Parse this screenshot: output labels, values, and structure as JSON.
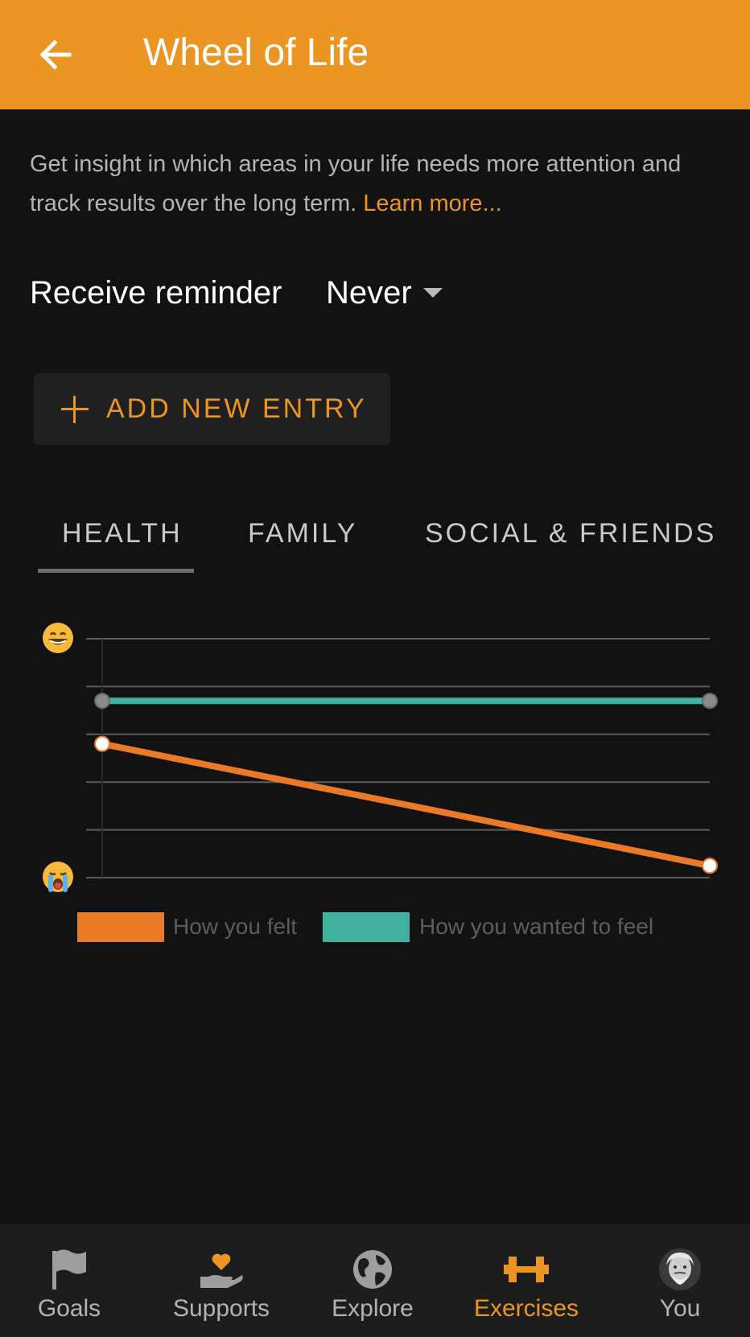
{
  "appbar": {
    "title": "Wheel of Life"
  },
  "intro": {
    "text": "Get insight in which areas in your life needs more attention and track results over the long term. ",
    "link": "Learn more..."
  },
  "reminder": {
    "label": "Receive reminder",
    "value": "Never"
  },
  "add_entry": {
    "label": "ADD NEW ENTRY"
  },
  "tabs": [
    {
      "label": "HEALTH",
      "selected": true
    },
    {
      "label": "FAMILY",
      "selected": false
    },
    {
      "label": "SOCIAL & FRIENDS",
      "selected": false
    }
  ],
  "chart_data": {
    "type": "line",
    "x": [
      1,
      2
    ],
    "ylim": [
      0,
      5
    ],
    "y_top_icon": "grinning-face-icon",
    "y_bottom_icon": "crying-face-icon",
    "grid": true,
    "series": [
      {
        "name": "How you felt",
        "values": [
          2.8,
          0.25
        ],
        "color": "#eb7a26"
      },
      {
        "name": "How you wanted to feel",
        "values": [
          3.7,
          3.7
        ],
        "color": "#41b2a1"
      }
    ]
  },
  "nav": [
    {
      "label": "Goals",
      "icon": "flag-icon",
      "active": false
    },
    {
      "label": "Supports",
      "icon": "heart-hand-icon",
      "active": false
    },
    {
      "label": "Explore",
      "icon": "globe-icon",
      "active": false
    },
    {
      "label": "Exercises",
      "icon": "dumbbell-icon",
      "active": true
    },
    {
      "label": "You",
      "icon": "avatar-icon",
      "active": false
    }
  ],
  "colors": {
    "accent": "#eb9523",
    "background": "#121212"
  }
}
